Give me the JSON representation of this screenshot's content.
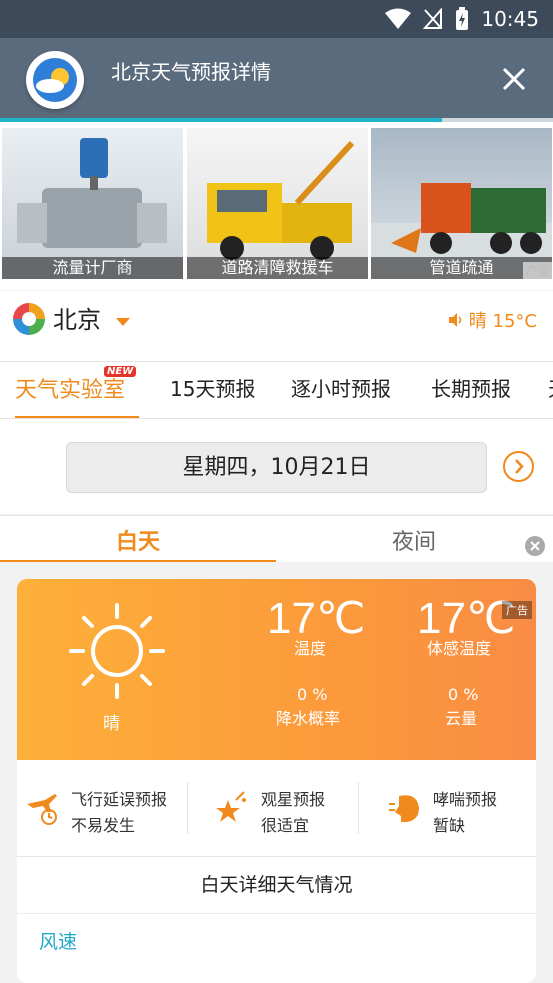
{
  "status_bar": {
    "time": "10:45"
  },
  "titlebar": {
    "title": "北京天气预报详情"
  },
  "progress": {
    "fraction": 0.8
  },
  "ads": {
    "items": [
      {
        "caption": "流量计厂商"
      },
      {
        "caption": "道路清障救援车"
      },
      {
        "caption": "管道疏通"
      }
    ],
    "tag": "广告"
  },
  "city": {
    "name": "北京",
    "weather": "晴 15°C"
  },
  "tabs": [
    {
      "label": "天气实验室",
      "badge": "NEW"
    },
    {
      "label": "15天预报"
    },
    {
      "label": "逐小时预报"
    },
    {
      "label": "长期预报"
    },
    {
      "label": "天"
    }
  ],
  "date": {
    "label": "星期四，10月21日"
  },
  "day_night": {
    "day": "白天",
    "night": "夜间"
  },
  "weather_card": {
    "condition": "晴",
    "temp": "17℃",
    "temp_label": "温度",
    "feels": "17℃",
    "feels_label": "体感温度",
    "precip": "0 %",
    "precip_label": "降水概率",
    "cloud": "0 %",
    "cloud_label": "云量",
    "ad_label": "广告"
  },
  "forecasts": [
    {
      "title": "飞行延误预报",
      "value": "不易发生",
      "icon": "airplane-clock-icon"
    },
    {
      "title": "观星预报",
      "value": "很适宜",
      "icon": "star-icon"
    },
    {
      "title": "哮喘预报",
      "value": "暂缺",
      "icon": "asthma-icon"
    }
  ],
  "details": {
    "title": "白天详细天气情况",
    "wind_label": "风速"
  },
  "colors": {
    "accent": "#f08a1c",
    "teal": "#22a8c9",
    "header": "#5b6b7e"
  }
}
